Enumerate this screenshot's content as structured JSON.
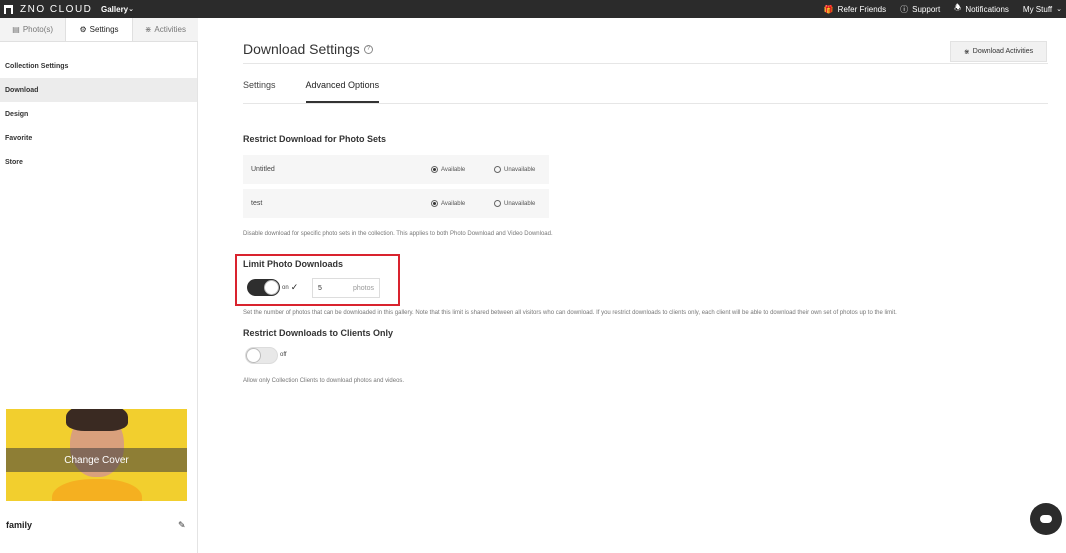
{
  "topbar": {
    "brand": "ZNO CLOUD",
    "gallery_menu": "Gallery",
    "refer_friends": "Refer Friends",
    "support": "Support",
    "notifications": "Notifications",
    "my_stuff": "My Stuff"
  },
  "sidebar": {
    "tabs": [
      {
        "label": "Photo(s)",
        "icon": "image-icon"
      },
      {
        "label": "Settings",
        "icon": "gear-icon"
      },
      {
        "label": "Activities",
        "icon": "rss-icon"
      }
    ],
    "items": [
      {
        "label": "Collection Settings"
      },
      {
        "label": "Download"
      },
      {
        "label": "Design"
      },
      {
        "label": "Favorite"
      },
      {
        "label": "Store"
      }
    ],
    "cover_button": "Change Cover",
    "album_name": "family"
  },
  "main": {
    "title": "Download Settings",
    "activities_button": "Download Activities",
    "subtabs": [
      {
        "label": "Settings"
      },
      {
        "label": "Advanced Options"
      }
    ],
    "restrict_sets": {
      "title": "Restrict Download for Photo Sets",
      "rows": [
        {
          "name": "Untitled",
          "available": "Available",
          "unavailable": "Unavailable",
          "selected": "Available"
        },
        {
          "name": "test",
          "available": "Available",
          "unavailable": "Unavailable",
          "selected": "Available"
        }
      ],
      "note": "Disable download for specific photo sets in the collection. This applies to both Photo Download and Video Download."
    },
    "limit_downloads": {
      "title": "Limit Photo Downloads",
      "toggle_label": "on",
      "value": "5",
      "unit": "photos",
      "note": "Set the number of photos that can be downloaded in this gallery. Note that this limit is shared between all visitors who can download. If you restrict downloads to clients only, each client will be able to download their own set of photos up to the limit."
    },
    "clients_only": {
      "title": "Restrict Downloads to Clients Only",
      "toggle_label": "off",
      "note": "Allow only Collection Clients to download photos and videos."
    }
  },
  "colors": {
    "topbar": "#2b2b2b",
    "highlight": "#d9232e",
    "cover": "#f2cf2e"
  }
}
